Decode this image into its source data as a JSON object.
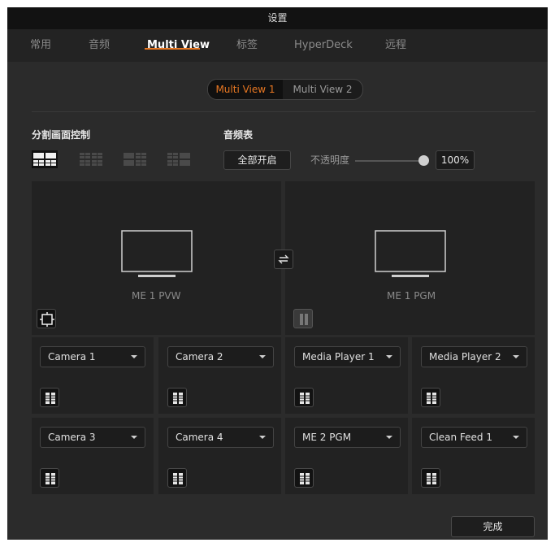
{
  "window": {
    "title": "设置"
  },
  "tabs": [
    {
      "label": "常用"
    },
    {
      "label": "音频"
    },
    {
      "label": "Multi View"
    },
    {
      "label": "标签"
    },
    {
      "label": "HyperDeck"
    },
    {
      "label": "远程"
    }
  ],
  "multiview_selector": {
    "options": [
      "Multi View 1",
      "Multi View 2"
    ],
    "selected": "Multi View 1"
  },
  "layout_control": {
    "label": "分割画面控制",
    "options": [
      "layout-2x2-icon",
      "layout-4x4-icon",
      "layout-2x2-4x4-icon",
      "layout-4x4-2x2-icon"
    ],
    "selected": "layout-2x2-icon"
  },
  "audio_meters": {
    "label": "音频表",
    "toggle_all_label": "全部开启",
    "opacity_label": "不透明度",
    "opacity_value": "100%",
    "opacity_level": 1.0
  },
  "large_views": [
    {
      "label": "ME 1 PVW",
      "icon": "safe-area-icon"
    },
    {
      "label": "ME 1 PGM",
      "icon": "audio-meter-icon"
    }
  ],
  "swap_icon": "swap-icon",
  "windows": [
    {
      "source": "Camera 1"
    },
    {
      "source": "Camera 2"
    },
    {
      "source": "Media Player 1"
    },
    {
      "source": "Media Player 2"
    },
    {
      "source": "Camera 3"
    },
    {
      "source": "Camera 4"
    },
    {
      "source": "ME 2 PGM"
    },
    {
      "source": "Clean Feed 1"
    }
  ],
  "footer": {
    "done_label": "完成"
  },
  "colors": {
    "accent": "#e87722",
    "background": "#2b2b2b",
    "panel": "#222222"
  }
}
